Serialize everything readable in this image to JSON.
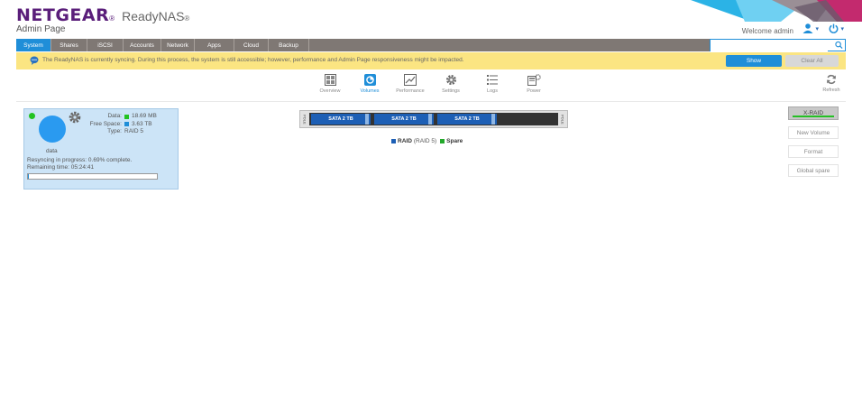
{
  "header": {
    "logo": "NETGEAR",
    "product": "ReadyNAS",
    "reg_mark": "®",
    "subtitle": "Admin Page",
    "welcome": "Welcome admin",
    "user_icon": "user-icon",
    "power_icon": "power-icon",
    "caret": "▾"
  },
  "nav": {
    "tabs": [
      "System",
      "Shares",
      "iSCSI",
      "Accounts",
      "Network",
      "Apps",
      "Cloud",
      "Backup"
    ],
    "active": "System"
  },
  "search": {
    "placeholder": "",
    "icon": "search-icon"
  },
  "banner": {
    "text": "The ReadyNAS is currently syncing. During this process, the system is still accessible; however, performance and Admin Page responsiveness might be impacted.",
    "show_label": "Show",
    "clear_label": "Clear All",
    "icon": "chat-icon"
  },
  "toolbar": {
    "items": [
      {
        "label": "Overview",
        "icon": "overview-icon"
      },
      {
        "label": "Volumes",
        "icon": "volumes-icon"
      },
      {
        "label": "Performance",
        "icon": "performance-icon"
      },
      {
        "label": "Settings",
        "icon": "settings-gear-icon"
      },
      {
        "label": "Logs",
        "icon": "logs-icon"
      },
      {
        "label": "Power",
        "icon": "power-settings-icon"
      }
    ],
    "active": "Volumes",
    "refresh_label": "Refresh"
  },
  "volume": {
    "name": "data",
    "data_label": "Data:",
    "data_value": "18.69 MB",
    "free_label": "Free Space:",
    "free_value": "3.63 TB",
    "type_label": "Type:",
    "type_value": "RAID 5",
    "resync_text": "Resyncing in progress: 0.69% complete.",
    "remaining_text": "Remaining time: 05:24:41",
    "progress_percent": 0.69,
    "status": "online",
    "colors": {
      "data": "#22c322",
      "free": "#1f8ed8"
    }
  },
  "disks": {
    "bays": [
      "SATA 2 TB",
      "SATA 2 TB",
      "SATA 2 TB"
    ],
    "left_label": "POLE",
    "right_label": "POLE"
  },
  "legend": {
    "raid_label": "RAID",
    "raid_type": "(RAID 5)",
    "spare_label": "Spare",
    "raid_color": "#1d5fb5",
    "spare_color": "#22a82a"
  },
  "actions": {
    "xraid_label": "X-RAID",
    "new_volume_label": "New Volume",
    "format_label": "Format",
    "global_spare_label": "Global spare"
  },
  "colors": {
    "brand": "#5a1e7a",
    "accent": "#1f8ed8",
    "navbar": "#7f7874",
    "banner": "#fbe582"
  }
}
